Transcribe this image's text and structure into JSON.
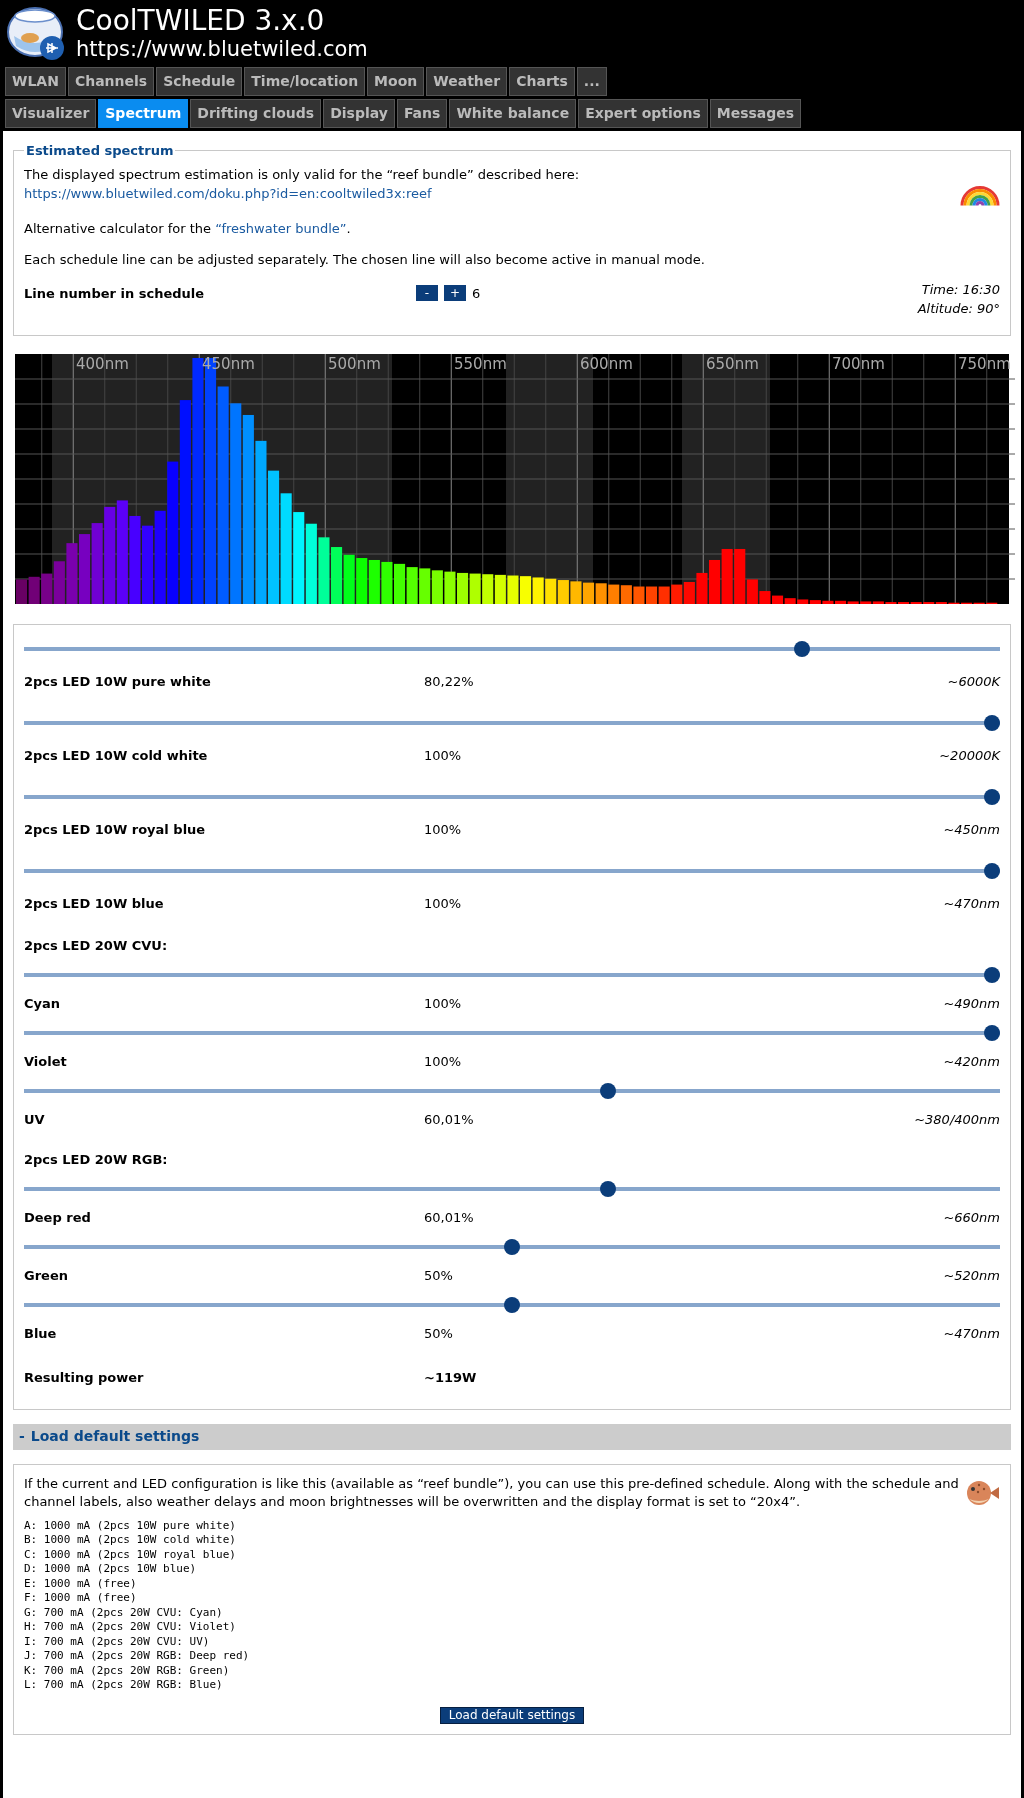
{
  "header": {
    "title": "CoolTWILED 3.x.0",
    "url": "https://www.bluetwiled.com"
  },
  "tabs_row1": [
    {
      "label": "WLAN",
      "selected": false
    },
    {
      "label": "Channels",
      "selected": false
    },
    {
      "label": "Schedule",
      "selected": false
    },
    {
      "label": "Time/location",
      "selected": false
    },
    {
      "label": "Moon",
      "selected": false
    },
    {
      "label": "Weather",
      "selected": false
    },
    {
      "label": "Charts",
      "selected": false
    },
    {
      "label": "...",
      "selected": false
    }
  ],
  "tabs_row2": [
    {
      "label": "Visualizer",
      "selected": false
    },
    {
      "label": "Spectrum",
      "selected": true
    },
    {
      "label": "Drifting clouds",
      "selected": false
    },
    {
      "label": "Display",
      "selected": false
    },
    {
      "label": "Fans",
      "selected": false
    },
    {
      "label": "White balance",
      "selected": false
    },
    {
      "label": "Expert options",
      "selected": false
    },
    {
      "label": "Messages",
      "selected": false
    }
  ],
  "estimated": {
    "legend": "Estimated spectrum",
    "intro": "The displayed spectrum estimation is only valid for the “reef bundle” described here:",
    "link": "https://www.bluetwiled.com/doku.php?id=en:cooltwiled3x:reef",
    "alt_prefix": "Alternative calculator for the ",
    "alt_link": "“freshwater bundle”",
    "alt_suffix": ".",
    "note": "Each schedule line can be adjusted separately. The chosen line will also become active in manual mode.",
    "line_label": "Line number in schedule",
    "minus": "-",
    "plus": "+",
    "line_value": "6",
    "time": "Time: 16:30",
    "altitude": "Altitude: 90°"
  },
  "spectrum_labels": [
    "400nm",
    "450nm",
    "500nm",
    "550nm",
    "600nm",
    "650nm",
    "700nm",
    "750nm"
  ],
  "channels": [
    {
      "kind": "channel",
      "name": "2pcs LED 10W pure white",
      "level": 0.8022,
      "percent": "80,22%",
      "reading": "~6000K"
    },
    {
      "kind": "channel",
      "name": "2pcs LED 10W cold white",
      "level": 1,
      "percent": "100%",
      "reading": "~20000K"
    },
    {
      "kind": "channel",
      "name": "2pcs LED 10W royal blue",
      "level": 1,
      "percent": "100%",
      "reading": "~450nm"
    },
    {
      "kind": "channel",
      "name": "2pcs LED 10W blue",
      "level": 1,
      "percent": "100%",
      "reading": "~470nm"
    },
    {
      "kind": "group",
      "name": "2pcs LED 20W CVU:"
    },
    {
      "kind": "channel",
      "name": "Cyan",
      "level": 1,
      "percent": "100%",
      "reading": "~490nm"
    },
    {
      "kind": "channel",
      "name": "Violet",
      "level": 1,
      "percent": "100%",
      "reading": "~420nm"
    },
    {
      "kind": "channel",
      "name": "UV",
      "level": 0.6001,
      "percent": "60,01%",
      "reading": "~380/400nm"
    },
    {
      "kind": "group",
      "name": "2pcs LED 20W RGB:"
    },
    {
      "kind": "channel",
      "name": "Deep red",
      "level": 0.6001,
      "percent": "60,01%",
      "reading": "~660nm"
    },
    {
      "kind": "channel",
      "name": "Green",
      "level": 0.5,
      "percent": "50%",
      "reading": "~520nm"
    },
    {
      "kind": "channel",
      "name": "Blue",
      "level": 0.5,
      "percent": "50%",
      "reading": "~470nm"
    },
    {
      "kind": "total",
      "name": "Resulting power",
      "percent": "~119W"
    }
  ],
  "defaults": {
    "toggle": "-",
    "title": "Load default settings",
    "text": "If the current and LED configuration is like this (available as “reef bundle”), you can use this pre-defined schedule. Along with the schedule and channel labels, also weather delays and moon brightnesses will be overwritten and the display format is set to “20x4”.",
    "lines": [
      "A: 1000 mA (2pcs 10W pure white)",
      "B: 1000 mA (2pcs 10W cold white)",
      "C: 1000 mA (2pcs 10W royal blue)",
      "D: 1000 mA (2pcs 10W blue)",
      "E: 1000 mA (free)",
      "F: 1000 mA (free)",
      "G: 700 mA (2pcs 20W CVU: Cyan)",
      "H: 700 mA (2pcs 20W CVU: Violet)",
      "I: 700 mA (2pcs 20W CVU: UV)",
      "J: 700 mA (2pcs 20W RGB: Deep red)",
      "K: 700 mA (2pcs 20W RGB: Green)",
      "L: 700 mA (2pcs 20W RGB: Blue)"
    ],
    "button": "Load default settings"
  }
}
